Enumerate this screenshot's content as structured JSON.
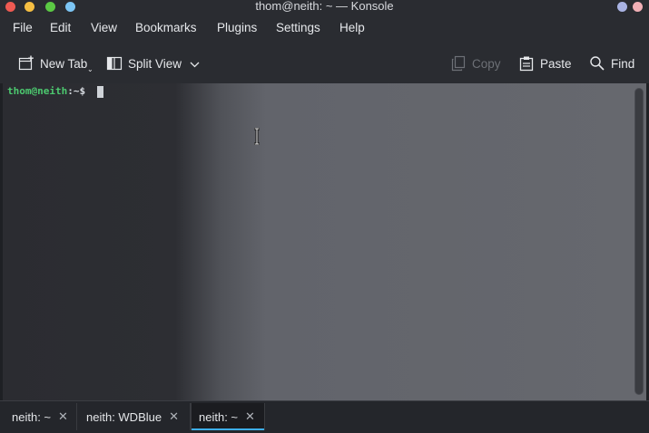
{
  "window": {
    "title": "thom@neith: ~ — Konsole"
  },
  "menu": [
    "File",
    "Edit",
    "View",
    "Bookmarks",
    "Plugins",
    "Settings",
    "Help"
  ],
  "toolbar": {
    "new_tab": "New Tab",
    "split_view": "Split View",
    "copy": "Copy",
    "paste": "Paste",
    "find": "Find"
  },
  "terminal": {
    "user_host": "thom@neith",
    "path_prompt": ":~$"
  },
  "tabs": [
    {
      "label": "neith: ~",
      "active": false
    },
    {
      "label": "neith: WDBlue",
      "active": false
    },
    {
      "label": "neith: ~",
      "active": true
    }
  ],
  "colors": {
    "accent": "#3daee9",
    "prompt_user": "#4cc96f"
  }
}
